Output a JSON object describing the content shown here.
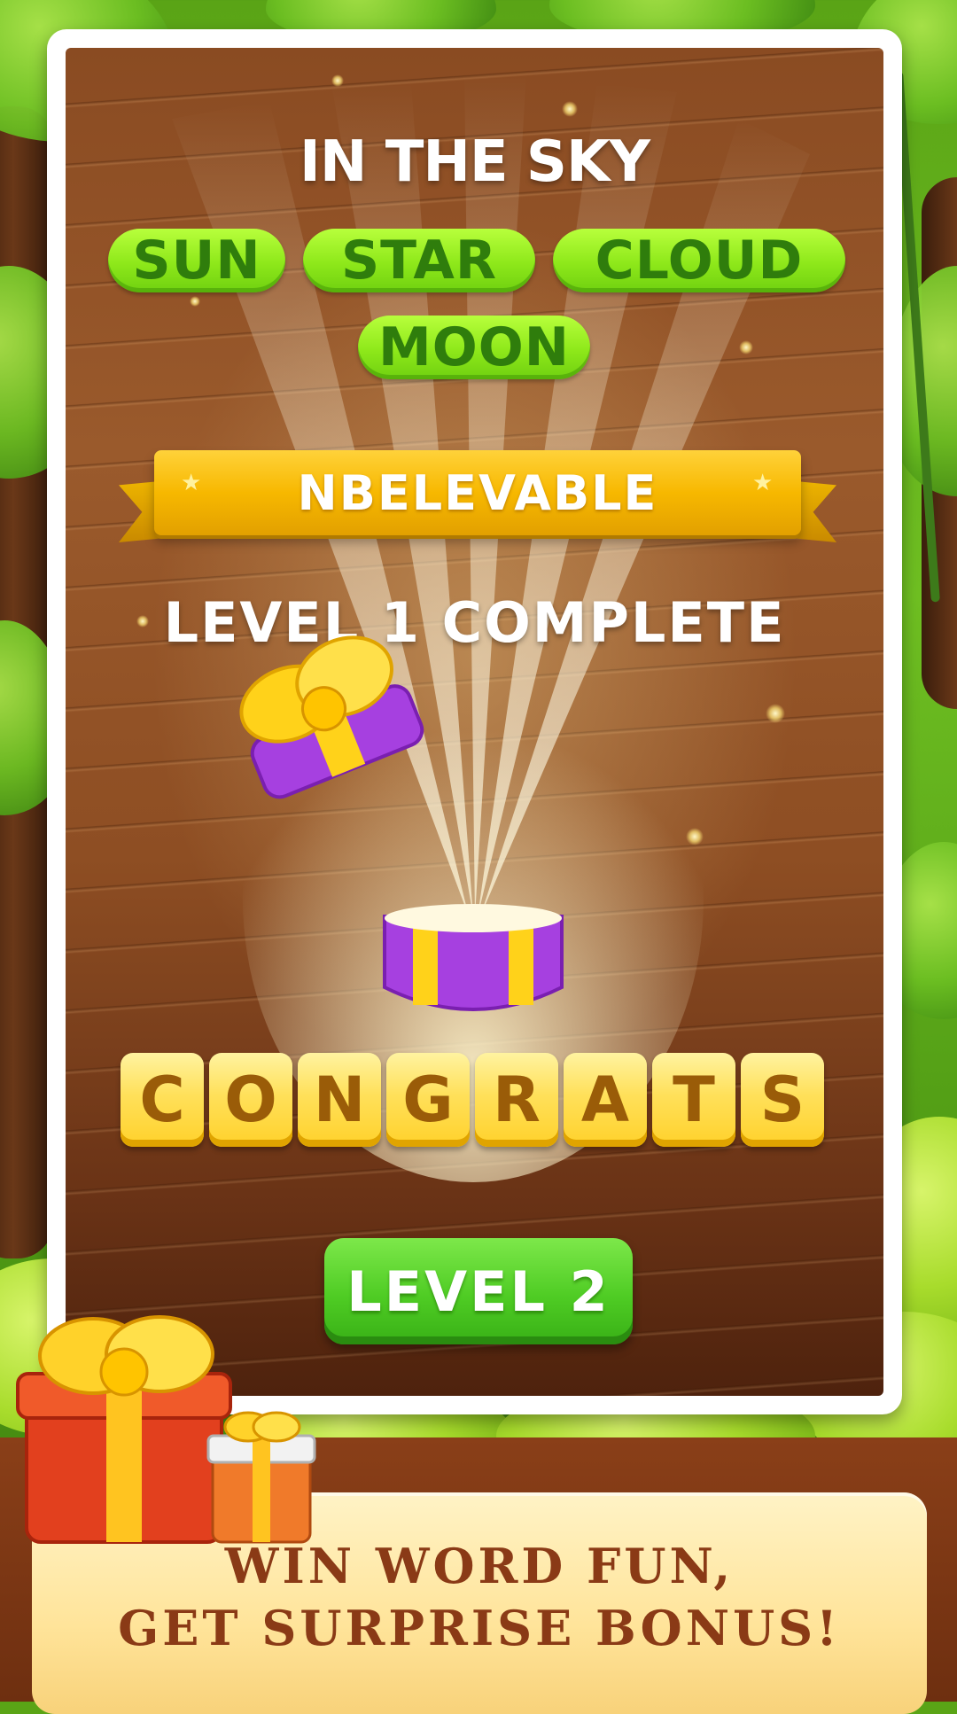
{
  "puzzle": {
    "category": "IN THE SKY",
    "words": [
      "SUN",
      "STAR",
      "CLOUD",
      "MOON"
    ]
  },
  "banner": {
    "text": "NBELEVABLE"
  },
  "status": {
    "level_complete": "LEVEL 1 COMPLETE"
  },
  "tiles": [
    "C",
    "O",
    "N",
    "G",
    "R",
    "A",
    "T",
    "S"
  ],
  "next_button": {
    "label": "LEVEL 2"
  },
  "promo": {
    "line1": "WIN WORD FUN,",
    "line2": "GET SURPRISE BONUS!"
  },
  "colors": {
    "word_pill": "#8ee81a",
    "word_text": "#2f7d0c",
    "ribbon": "#f7b800",
    "tile": "#ffe05a",
    "tile_text": "#9a5c08",
    "button": "#4fcc24",
    "promo_text": "#8a3a16"
  },
  "icons": [
    "gift-box-icon",
    "present-icon",
    "star-icon"
  ]
}
